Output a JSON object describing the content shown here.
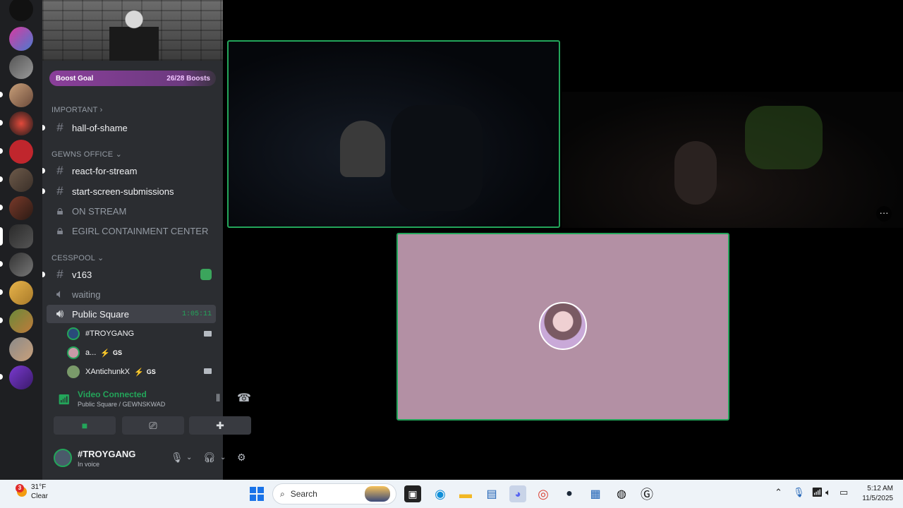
{
  "sidebar": {
    "boost": {
      "label": "Boost Goal",
      "count": "26/28 Boosts"
    },
    "categories": [
      {
        "label": "IMPORTANT ›"
      },
      {
        "label": "GEWNS OFFICE ⌄"
      },
      {
        "label": "CESSPOOL ⌄"
      }
    ],
    "channels": [
      {
        "label": "hall-of-shame",
        "icon": "hash"
      },
      {
        "label": "react-for-stream",
        "icon": "hash"
      },
      {
        "label": "start-screen-submissions",
        "icon": "hash"
      },
      {
        "label": "ON STREAM",
        "icon": "lock"
      },
      {
        "label": "EGIRL CONTAINMENT CENTER",
        "icon": "lock"
      },
      {
        "label": "v163",
        "icon": "hash"
      },
      {
        "label": "waiting",
        "icon": "speaker"
      },
      {
        "label": "Public Square",
        "icon": "speaker",
        "timer": "1:05:11"
      }
    ],
    "voice_users": [
      {
        "name": "#TROYGANG"
      },
      {
        "name": "a...",
        "tag": "GS"
      },
      {
        "name": "XAntichunkX",
        "tag": "GS"
      }
    ]
  },
  "voice_panel": {
    "title": "Video Connected",
    "subtitle": "Public Square / GEWNSKWAD"
  },
  "user_panel": {
    "name": "#TROYGANG",
    "status": "In voice"
  },
  "taskbar": {
    "weather_temp": "31°F",
    "weather_desc": "Clear",
    "weather_badge": "3",
    "search_placeholder": "Search",
    "time": "5:12 AM",
    "date": "11/5/2025"
  },
  "colors": {
    "accent_green": "#23a55a",
    "sidebar": "#2b2d31",
    "rail": "#1e1f22"
  }
}
